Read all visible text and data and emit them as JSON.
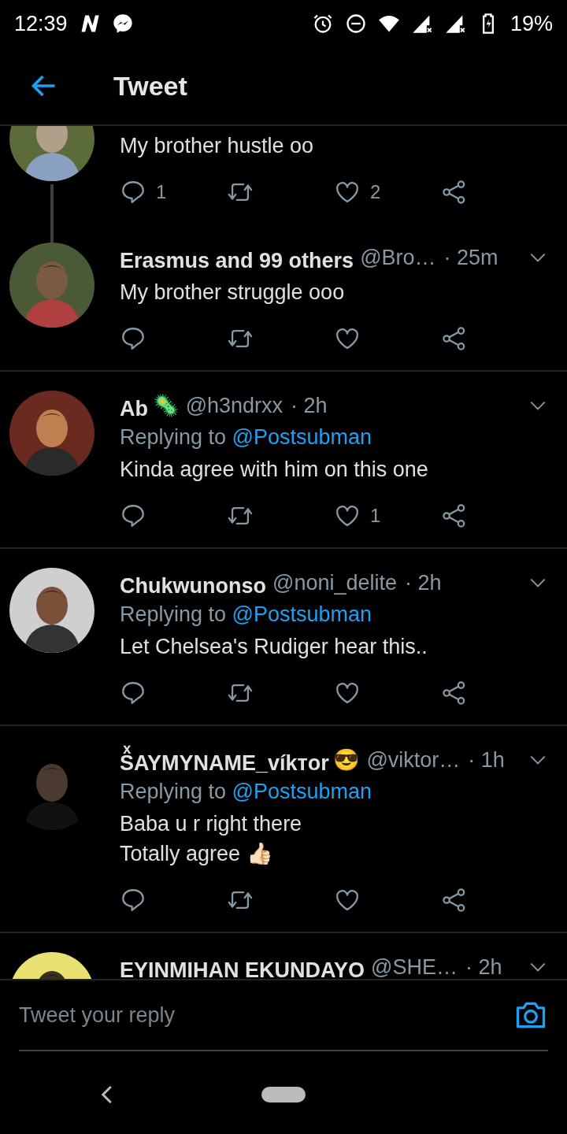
{
  "status_bar": {
    "time": "12:39",
    "battery": "19%"
  },
  "header": {
    "title": "Tweet"
  },
  "tweets": [
    {
      "partial": true,
      "thread": true,
      "text": [
        "My brother hustle oo"
      ],
      "replies": "1",
      "likes": "2"
    },
    {
      "name": "Erasmus and 99 others",
      "handle": "@Bro…",
      "time": "· 25m",
      "text": [
        "My brother struggle ooo"
      ]
    },
    {
      "name": "Ab",
      "name_emoji": "🦠",
      "handle": "@h3ndrxx",
      "time": "· 2h",
      "replying_to": {
        "label": "Replying to",
        "user": "@Postsubman"
      },
      "text": [
        "Kinda agree with him on this one"
      ],
      "likes": "1"
    },
    {
      "name": "Chukwunonso",
      "handle": "@noni_delite",
      "time": "· 2h",
      "replying_to": {
        "label": "Replying to",
        "user": "@Postsubman"
      },
      "text": [
        "Let Chelsea's Rudiger hear this.."
      ]
    },
    {
      "name": "SͯAYMYNAME_víkᴛor",
      "name_emoji": "😎",
      "handle": "@viktor…",
      "time": "· 1h",
      "replying_to": {
        "label": "Replying to",
        "user": "@Postsubman"
      },
      "text": [
        "Baba u r right there",
        "Totally agree 👍🏻"
      ]
    },
    {
      "name": "EYINMIHAN EKUNDAYO",
      "handle": "@SHE…",
      "time": "· 2h",
      "cut": true
    }
  ],
  "composer": {
    "placeholder": "Tweet your reply"
  }
}
